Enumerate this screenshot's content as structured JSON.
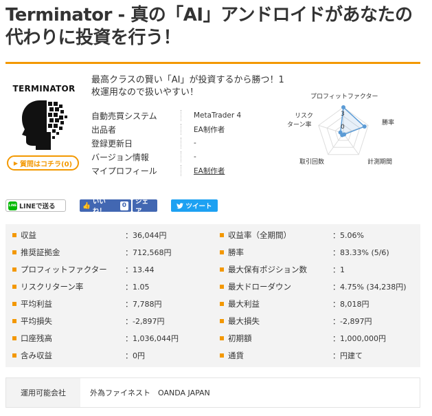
{
  "title": "Terminator - 真の「AI」アンドロイドがあなたの代わりに投資を行う！",
  "logo": {
    "text": "TERMINATOR"
  },
  "ask_button": {
    "label": "質問はコチラ(0)"
  },
  "tagline": "最高クラスの賢い「AI」が投資するから勝つ！1枚運用なので扱いやすい！",
  "info": [
    {
      "key": "自動売買システム",
      "value": "MetaTrader 4",
      "link": false
    },
    {
      "key": "出品者",
      "value": "EA制作者",
      "link": false
    },
    {
      "key": "登録更新日",
      "value": "-",
      "link": false
    },
    {
      "key": "バージョン情報",
      "value": "-",
      "link": false
    },
    {
      "key": "マイプロフィール",
      "value": "EA制作者",
      "link": true
    }
  ],
  "radar": {
    "labels": {
      "profit_factor": "プロフィットファクター",
      "win_rate": "勝率",
      "period": "計測期間",
      "trades": "取引回数",
      "risk_return_1": "リスク",
      "risk_return_2": "ターン率"
    },
    "tick_max": "3",
    "tick_min": "0",
    "values": {
      "profit_factor": 1.0,
      "win_rate": 0.85,
      "period": 0.05,
      "trades": 0.08,
      "risk_return": 0.12
    },
    "color": "#5b9bd5"
  },
  "share": {
    "line": "LINEで送る",
    "line_icon": "LINE",
    "fb_like": "いいね！",
    "fb_count": "0",
    "fb_share": "シェア",
    "tweet": "ツイート"
  },
  "stats": [
    {
      "key": "収益",
      "value": "：36,044円"
    },
    {
      "key": "収益率（全期間）",
      "value": "：5.06%"
    },
    {
      "key": "推奨証拠金",
      "value": "：712,568円"
    },
    {
      "key": "勝率",
      "value": "：83.33% (5/6)"
    },
    {
      "key": "プロフィットファクター",
      "value": "：13.44"
    },
    {
      "key": "最大保有ポジション数",
      "value": "：1"
    },
    {
      "key": "リスクリターン率",
      "value": "：1.05"
    },
    {
      "key": "最大ドローダウン",
      "value": "：4.75% (34,238円)"
    },
    {
      "key": "平均利益",
      "value": "：7,788円"
    },
    {
      "key": "最大利益",
      "value": "：8,018円"
    },
    {
      "key": "平均損失",
      "value": "：-2,897円"
    },
    {
      "key": "最大損失",
      "value": "：-2,897円"
    },
    {
      "key": "口座残高",
      "value": "：1,036,044円"
    },
    {
      "key": "初期額",
      "value": "：1,000,000円"
    },
    {
      "key": "含み収益",
      "value": "：0円"
    },
    {
      "key": "通貨",
      "value": "：円建て"
    }
  ],
  "broker": {
    "key": "運用可能会社",
    "value": "外為ファイネスト　OANDA JAPAN"
  },
  "colors": {
    "accent": "#f39800",
    "facebook": "#4267b2",
    "twitter": "#1da1f2",
    "line": "#00b900"
  }
}
